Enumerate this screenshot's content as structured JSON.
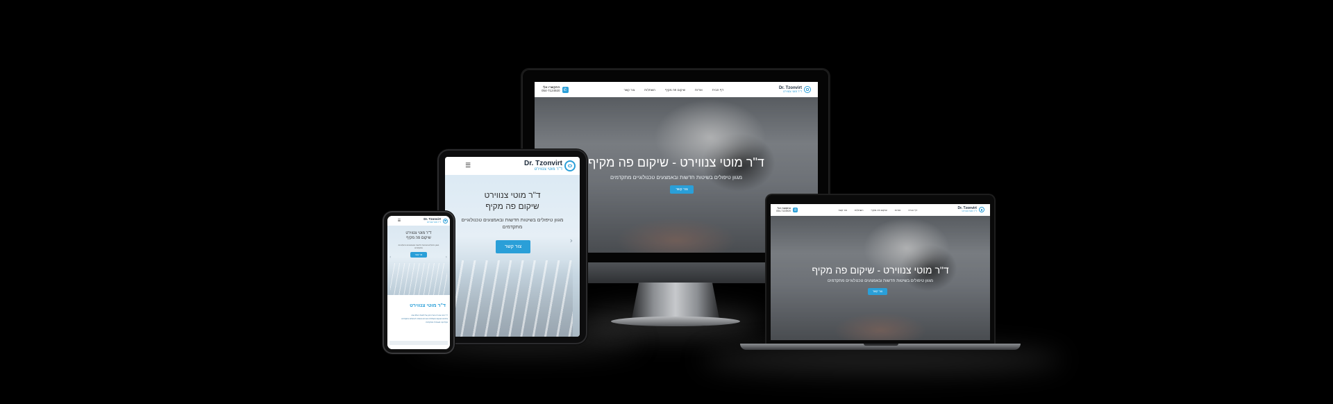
{
  "site": {
    "logo_en": "Dr. Tzonvirt",
    "logo_he": "ד\"ר מוטי צנווירט",
    "nav": [
      "דף הבית",
      "אודות",
      "שיקום פה מקיף",
      "השתלות",
      "צור קשר"
    ],
    "phone_label": "התקשרו אלי",
    "phone_number": "054-7124920",
    "hero_title": "ד\"ר מוטי צנווירט - שיקום פה מקיף",
    "hero_title_line1": "ד\"ר מוטי צנווירט",
    "hero_title_line2": "שיקום פה מקיף",
    "hero_subtitle": "מגוון טיפולים בשיטות חדשות ובאמצעים טכנולוגיים מתקדמים",
    "hero_subtitle_line1": "מגוון טיפולים בשיטות חדשות ובאמצעים טכנולוגיים",
    "hero_subtitle_line2": "מתקדמים",
    "cta_label": "צור קשר",
    "about_title": "ד\"ר מוטי צנווירט",
    "about_text_1": "ד\"ר מוטי צנווירט בעל ניסיון של למעלה מ-25 שנה",
    "about_text_2": "בתחום השיקום והשתלות השיניים ומומחה לטיפולים מתקדמים",
    "about_text_3": "בקליניקה מאובזרת ומתקדמת"
  },
  "icons": {
    "menu": "hamburger-menu-icon",
    "phone": "phone-icon",
    "prev": "chevron-left-icon",
    "next": "chevron-right-icon"
  },
  "colors": {
    "accent": "#2a9fd8",
    "background": "#000000",
    "logo_dark": "#1c2a3a"
  }
}
